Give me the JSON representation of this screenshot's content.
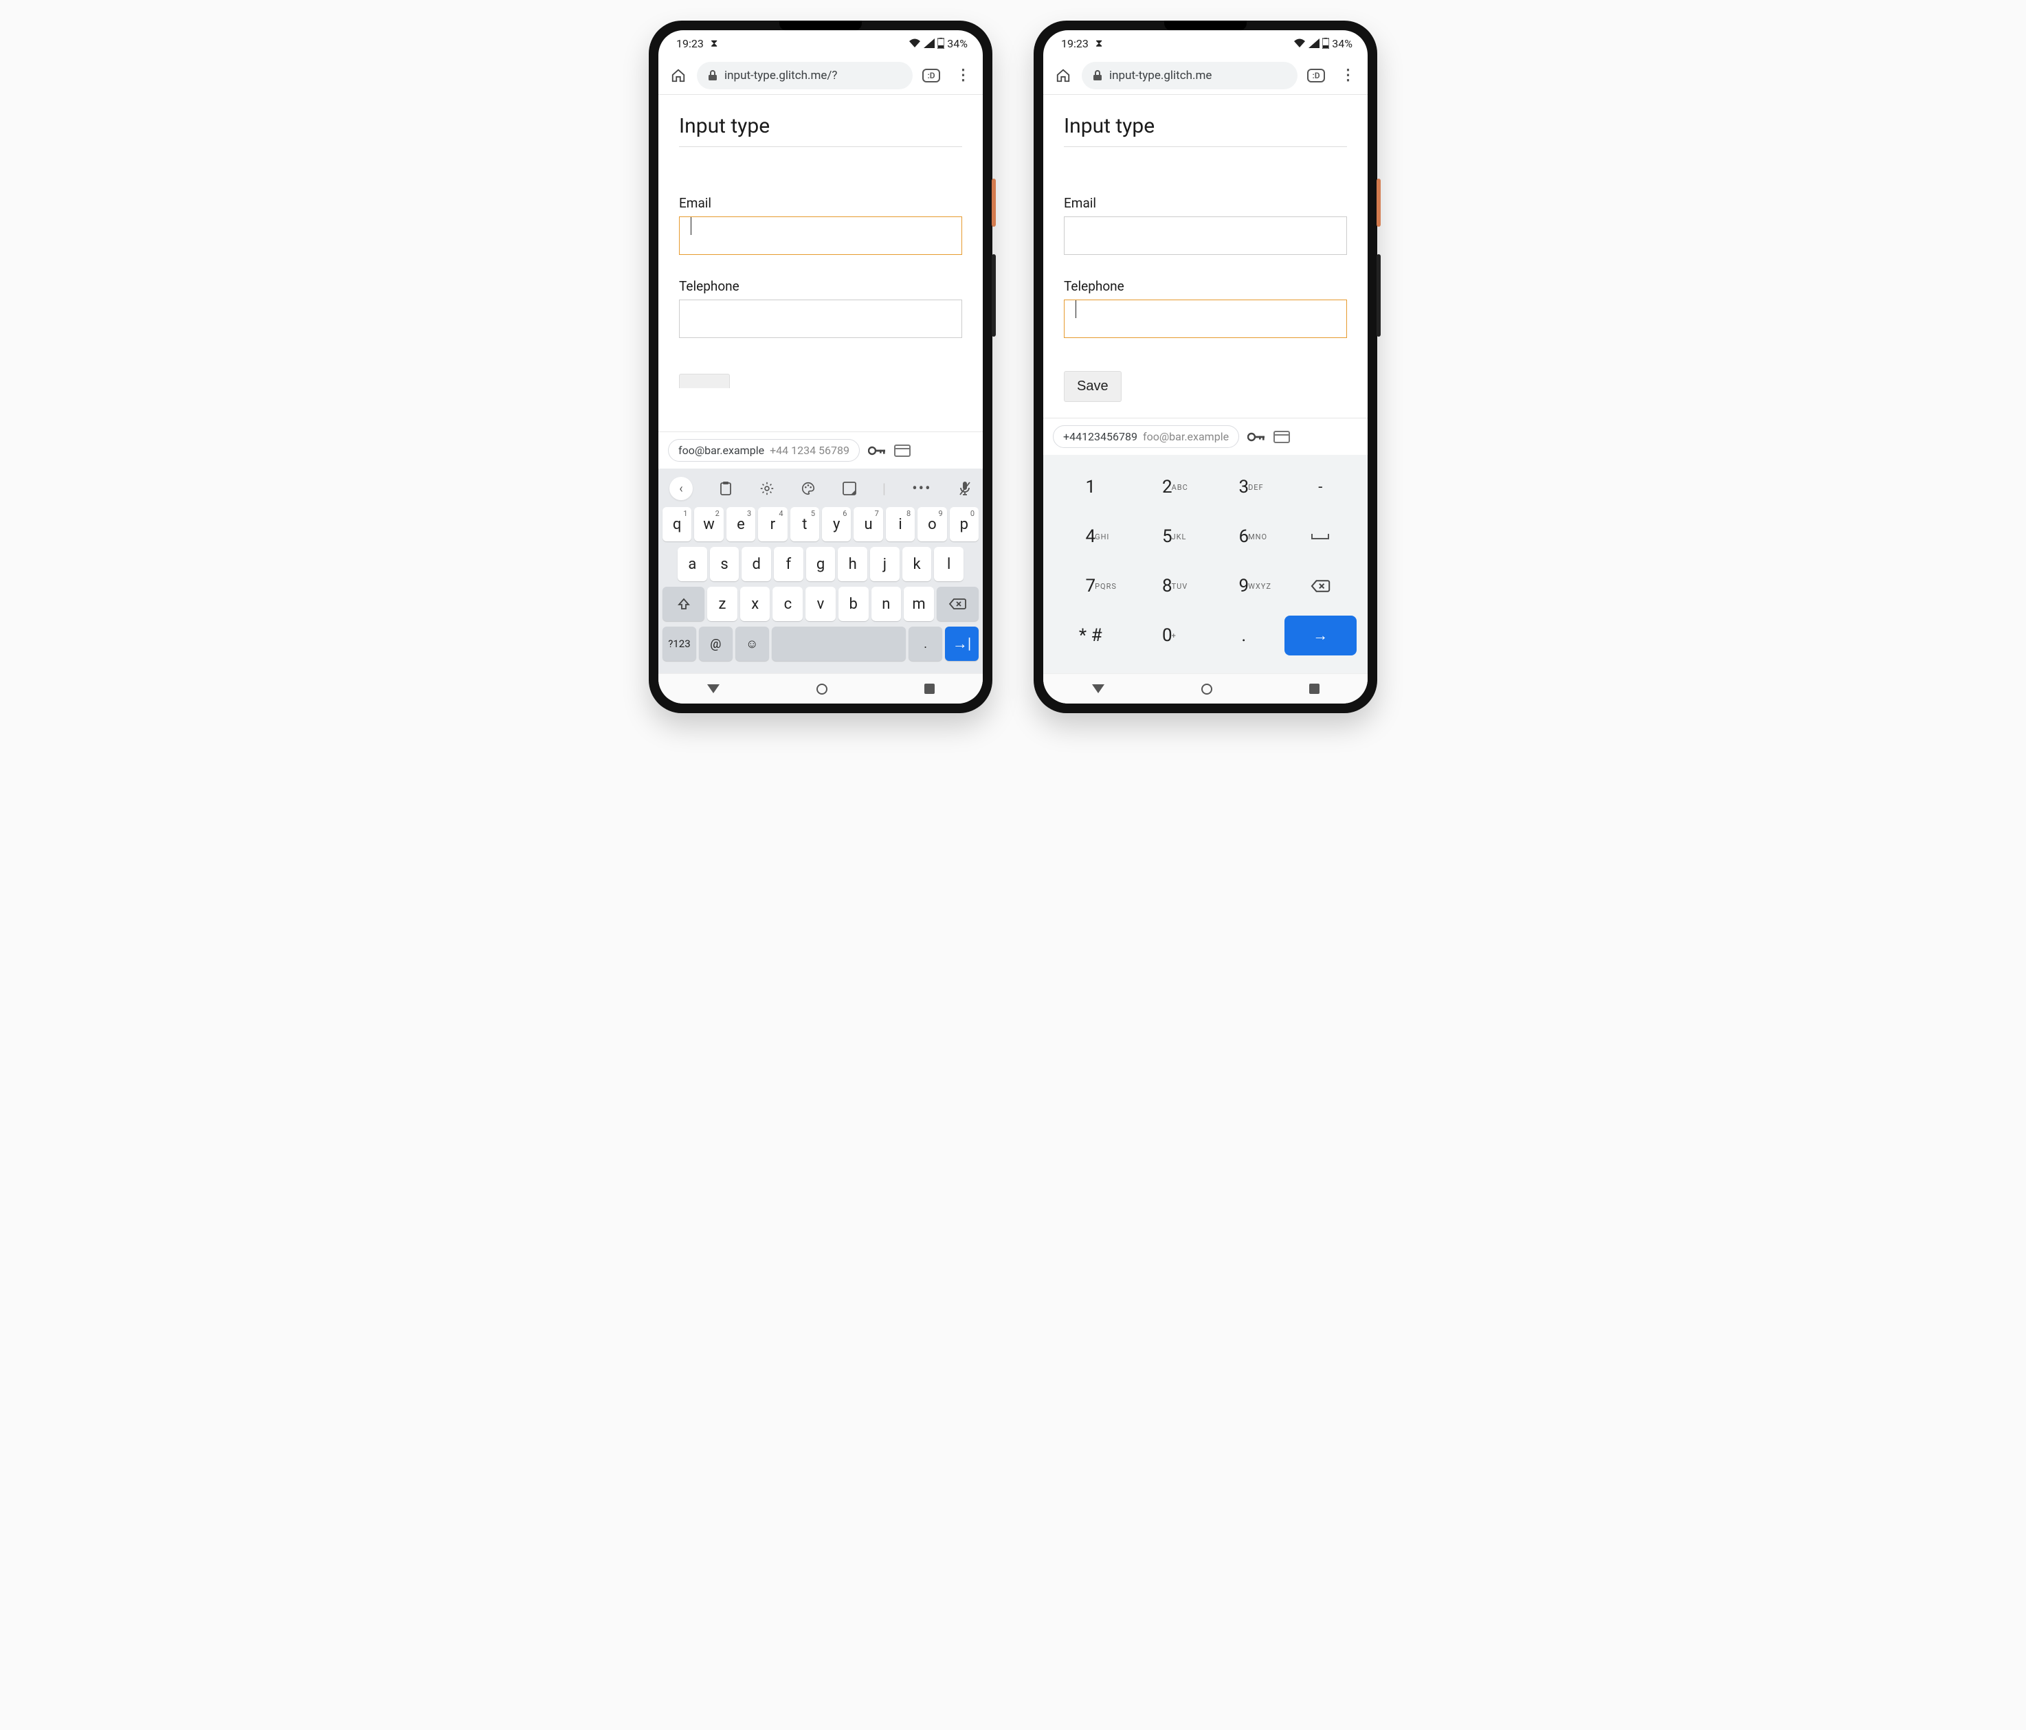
{
  "statusbar": {
    "time": "19:23",
    "battery": "34%"
  },
  "browser": {
    "url_left": "input-type.glitch.me/?",
    "url_right": "input-type.glitch.me",
    "tab_badge": ":D"
  },
  "page": {
    "title": "Input type",
    "email_label": "Email",
    "telephone_label": "Telephone",
    "save_label": "Save"
  },
  "autofill": {
    "email": "foo@bar.example",
    "phone": "+44 1234 56789",
    "phone_compact": "+44123456789"
  },
  "qwerty": {
    "row1": [
      {
        "k": "q",
        "s": "1"
      },
      {
        "k": "w",
        "s": "2"
      },
      {
        "k": "e",
        "s": "3"
      },
      {
        "k": "r",
        "s": "4"
      },
      {
        "k": "t",
        "s": "5"
      },
      {
        "k": "y",
        "s": "6"
      },
      {
        "k": "u",
        "s": "7"
      },
      {
        "k": "i",
        "s": "8"
      },
      {
        "k": "o",
        "s": "9"
      },
      {
        "k": "p",
        "s": "0"
      }
    ],
    "row2": [
      "a",
      "s",
      "d",
      "f",
      "g",
      "h",
      "j",
      "k",
      "l"
    ],
    "row3": [
      "z",
      "x",
      "c",
      "v",
      "b",
      "n",
      "m"
    ],
    "sym_key": "?123",
    "at_key": "@",
    "dot_key": "."
  },
  "dialpad": {
    "keys": [
      [
        {
          "n": "1",
          "l": ""
        },
        {
          "n": "2",
          "l": "ABC"
        },
        {
          "n": "3",
          "l": "DEF"
        },
        {
          "n": "-",
          "l": "",
          "func": true
        }
      ],
      [
        {
          "n": "4",
          "l": "GHI"
        },
        {
          "n": "5",
          "l": "JKL"
        },
        {
          "n": "6",
          "l": "MNO"
        },
        {
          "n": "⎵",
          "l": "",
          "func": true,
          "space": true
        }
      ],
      [
        {
          "n": "7",
          "l": "PQRS"
        },
        {
          "n": "8",
          "l": "TUV"
        },
        {
          "n": "9",
          "l": "WXYZ"
        },
        {
          "n": "bksp",
          "l": "",
          "func": true
        }
      ],
      [
        {
          "n": "* #",
          "l": ""
        },
        {
          "n": "0",
          "l": "+"
        },
        {
          "n": ".",
          "l": ""
        },
        {
          "n": "enter",
          "l": "",
          "func": true
        }
      ]
    ]
  }
}
